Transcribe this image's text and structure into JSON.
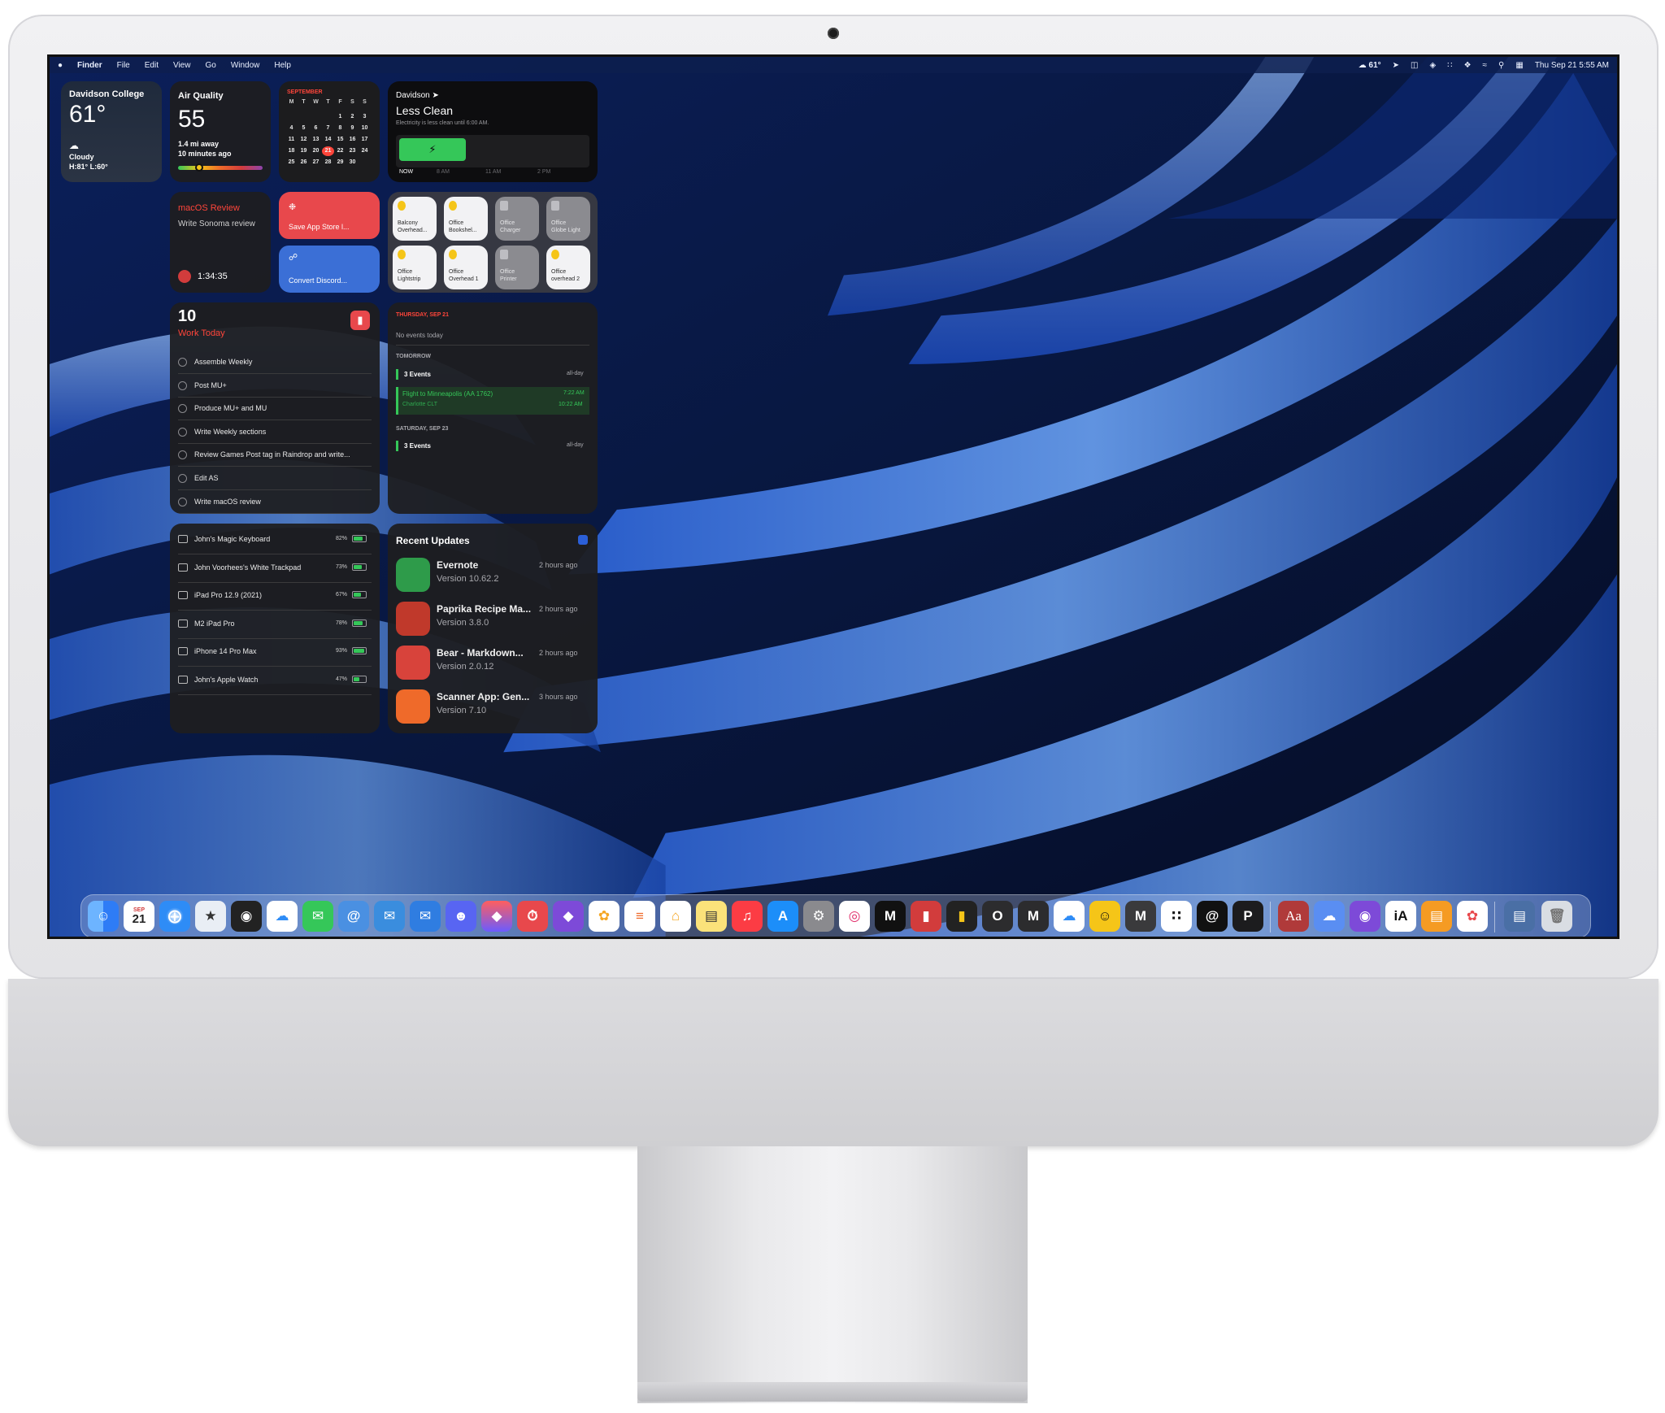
{
  "menubar": {
    "apple": "",
    "app": "Finder",
    "menus": [
      "File",
      "Edit",
      "View",
      "Go",
      "Window",
      "Help"
    ],
    "weather": "61°",
    "clock": "Thu Sep 21  5:55 AM"
  },
  "weather": {
    "location": "Davidson College",
    "temp": "61°",
    "condition": "Cloudy",
    "hilo": "H:81° L:60°"
  },
  "air_quality": {
    "title": "Air Quality",
    "value": "55",
    "distance": "1.4 mi away",
    "updated": "10 minutes ago",
    "level": 0.25
  },
  "calendar": {
    "month": "SEPTEMBER",
    "weekdays": [
      "M",
      "T",
      "W",
      "T",
      "F",
      "S",
      "S"
    ],
    "weeks": [
      [
        "",
        "",
        "",
        "",
        "1",
        "2",
        "3"
      ],
      [
        "4",
        "5",
        "6",
        "7",
        "8",
        "9",
        "10"
      ],
      [
        "11",
        "12",
        "13",
        "14",
        "15",
        "16",
        "17"
      ],
      [
        "18",
        "19",
        "20",
        "21",
        "22",
        "23",
        "24"
      ],
      [
        "25",
        "26",
        "27",
        "28",
        "29",
        "30",
        ""
      ]
    ],
    "today": "21"
  },
  "grid": {
    "location": "Davidson",
    "status": "Less Clean",
    "detail": "Electricity is less clean until 6:00 AM.",
    "labels": [
      "NOW",
      "8 AM",
      "11 AM",
      "2 PM"
    ]
  },
  "timer": {
    "title": "macOS Review",
    "task": "Write Sonoma review",
    "time": "1:34:35"
  },
  "shortcuts": {
    "first": "Save App Store l...",
    "second": "Convert Discord..."
  },
  "home": {
    "accessories": [
      {
        "label": "Balcony\nOverhead...",
        "on": true
      },
      {
        "label": "Office\nBookshel...",
        "on": true
      },
      {
        "label": "Office\nCharger",
        "on": false
      },
      {
        "label": "Office\nGlobe Light",
        "on": false
      },
      {
        "label": "Office\nLightstrip",
        "on": true
      },
      {
        "label": "Office\nOverhead 1",
        "on": true
      },
      {
        "label": "Office\nPrinter",
        "on": false
      },
      {
        "label": "Office\noverhead 2",
        "on": true
      }
    ]
  },
  "tasks": {
    "count": "10",
    "list": "Work Today",
    "items": [
      "Assemble Weekly",
      "Post MU+",
      "Produce MU+ and MU",
      "Write Weekly sections",
      "Review Games Post tag in Raindrop and write...",
      "Edit AS",
      "Write macOS review"
    ]
  },
  "events": {
    "day1": "THURSDAY, SEP 21",
    "no_events": "No events today",
    "tomorrow": "TOMORROW",
    "tomorrow_events": "3 Events",
    "allday": "all-day",
    "flight": "Flight to Minneapolis (AA 1762)",
    "flight_loc": "Charlotte CLT",
    "flight_start": "7:22 AM",
    "flight_end": "10:22 AM",
    "day2": "SATURDAY, SEP 23",
    "day2_events": "3 Events",
    "allday2": "all-day"
  },
  "battery": {
    "devices": [
      {
        "name": "John's Magic Keyboard",
        "pct": "82%",
        "level": 0.82
      },
      {
        "name": "John Voorhees's White Trackpad",
        "pct": "73%",
        "level": 0.73
      },
      {
        "name": "iPad Pro 12.9 (2021)",
        "pct": "67%",
        "level": 0.67
      },
      {
        "name": "M2 iPad Pro",
        "pct": "78%",
        "level": 0.78
      },
      {
        "name": "iPhone 14 Pro Max",
        "pct": "93%",
        "level": 0.93
      },
      {
        "name": "John's Apple Watch",
        "pct": "47%",
        "level": 0.47
      }
    ]
  },
  "updates": {
    "title": "Recent Updates",
    "items": [
      {
        "name": "Evernote",
        "version": "Version 10.62.2",
        "time": "2 hours ago",
        "color": "#2e9b4a"
      },
      {
        "name": "Paprika Recipe Ma...",
        "version": "Version 3.8.0",
        "time": "2 hours ago",
        "color": "#c0392b"
      },
      {
        "name": "Bear - Markdown...",
        "version": "Version 2.0.12",
        "time": "2 hours ago",
        "color": "#d8433b"
      },
      {
        "name": "Scanner App: Gen...",
        "version": "Version 7.10",
        "time": "3 hours ago",
        "color": "#ef6a2a"
      }
    ]
  },
  "dock": {
    "calendar_month": "SEP",
    "calendar_day": "21",
    "letter_icons": {
      "m1": "M",
      "o": "O",
      "m2": "M",
      "m3": "M",
      "p": "P",
      "aa": "Aa",
      "ia": "iA"
    }
  }
}
